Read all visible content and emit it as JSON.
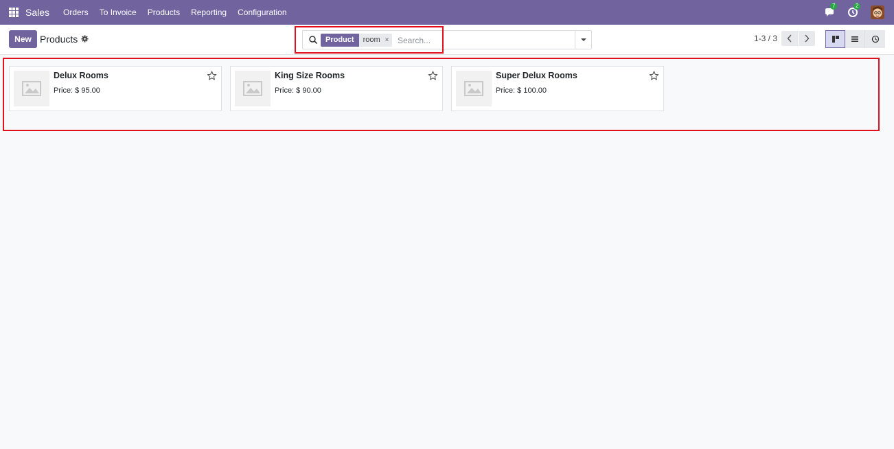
{
  "navbar": {
    "app_name": "Sales",
    "menu": [
      "Orders",
      "To Invoice",
      "Products",
      "Reporting",
      "Configuration"
    ],
    "messages_count": "7",
    "activities_count": "2",
    "accent_color": "#71639e",
    "badge_color": "#28a745"
  },
  "control_panel": {
    "new_label": "New",
    "title": "Products",
    "search": {
      "facet_label": "Product",
      "facet_value": "room",
      "facet_remove": "×",
      "placeholder": "Search..."
    },
    "pager": "1-3 / 3"
  },
  "products": [
    {
      "name": "Delux Rooms",
      "price": "Price: $ 95.00"
    },
    {
      "name": "King Size Rooms",
      "price": "Price: $ 90.00"
    },
    {
      "name": "Super Delux Rooms",
      "price": "Price: $ 100.00"
    }
  ],
  "icons": {
    "apps": "apps-grid-icon",
    "messages": "chat-icon",
    "activities": "clock-icon",
    "settings": "gear-icon",
    "search": "search-icon",
    "image_placeholder": "image-icon",
    "favorite": "star-icon",
    "views": [
      "kanban-icon",
      "list-icon",
      "activity-icon"
    ]
  },
  "annotation_color": "#e0101d"
}
